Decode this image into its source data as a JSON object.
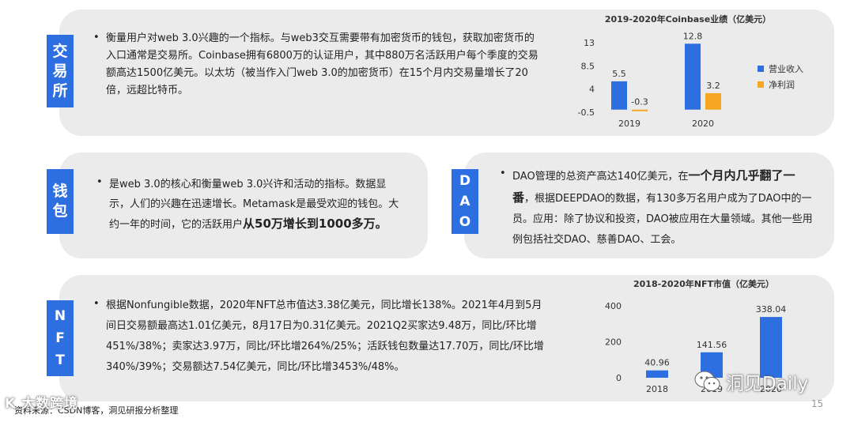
{
  "sections": {
    "exchange": {
      "tag": [
        "交",
        "易",
        "所"
      ],
      "text": "衡量用户对web 3.0兴趣的一个指标。与web3交互需要带有加密货币的钱包，获取加密货币的入口通常是交易所。Coinbase拥有6800万的认证用户，其中880万名活跃用户每个季度的交易额高达1500亿美元。以太坊（被当作入门web 3.0的加密货币）在15个月内交易量增长了20倍，远超比特币。"
    },
    "wallet": {
      "tag": [
        "钱",
        "包"
      ],
      "text_plain": "是web 3.0的核心和衡量web 3.0兴许和活动的指标。数据显示，人们的兴趣在迅速增长。Metamask是最受欢迎的钱包。大约一年的时间，它的活跃用户",
      "text_bold": "从50万增长到1000多万。"
    },
    "dao": {
      "tag": [
        "D",
        "A",
        "O"
      ],
      "text_pre": "DAO管理的总资产高达140亿美元，在",
      "text_bold": "一个月内几乎翻了一番",
      "text_post": "，根据DEEPDAO的数据，有130多万名用户成为了DAO中的一员。应用：除了协议和投资，DAO被应用在大量领域。其他一些用例包括社交DAO、慈善DAO、工会。"
    },
    "nft": {
      "tag": [
        "N",
        "F",
        "T"
      ],
      "text": "根据Nonfungible数据，2020年NFT总市值达3.38亿美元，同比增长138%。2021年4月到5月间日交易额最高达1.01亿美元，8月17日为0.31亿美元。2021Q2买家达9.48万，同比/环比增451%/38%；卖家达3.97万，同比/环比增264%/25%；活跃钱包数量达17.70万，同比/环比增340%/39%；交易额达7.54亿美元，同比/环比增3453%/48%。"
    }
  },
  "bullet": "•",
  "chart_data": [
    {
      "type": "bar",
      "title": "2019-2020年Coinbase业绩（亿美元）",
      "categories": [
        "2019",
        "2020"
      ],
      "series": [
        {
          "name": "营业收入",
          "values": [
            5.5,
            12.8
          ],
          "color": "#2d6fe0"
        },
        {
          "name": "净利润",
          "values": [
            -0.3,
            3.2
          ],
          "color": "#f5a623"
        }
      ],
      "yticks": [
        "13",
        "8.5",
        "4",
        "-0.5"
      ],
      "ylim": [
        -0.5,
        13
      ],
      "legend": "right",
      "grid": false
    },
    {
      "type": "bar",
      "title": "2018-2020年NFT市值（亿美元）",
      "categories": [
        "2018",
        "2019",
        "2020"
      ],
      "values": [
        40.96,
        141.56,
        338.04
      ],
      "labels": [
        "40.96",
        "141.56",
        "338.04"
      ],
      "color": "#2d6fe0",
      "yticks": [
        "400",
        "200",
        "0"
      ],
      "ylim": [
        0,
        400
      ],
      "grid": false
    }
  ],
  "footer": "资料来源：CSDN博客，洞见研报分析整理",
  "page_number": "15",
  "watermark_right": "洞见Daily",
  "watermark_left": "K 大数跨境"
}
